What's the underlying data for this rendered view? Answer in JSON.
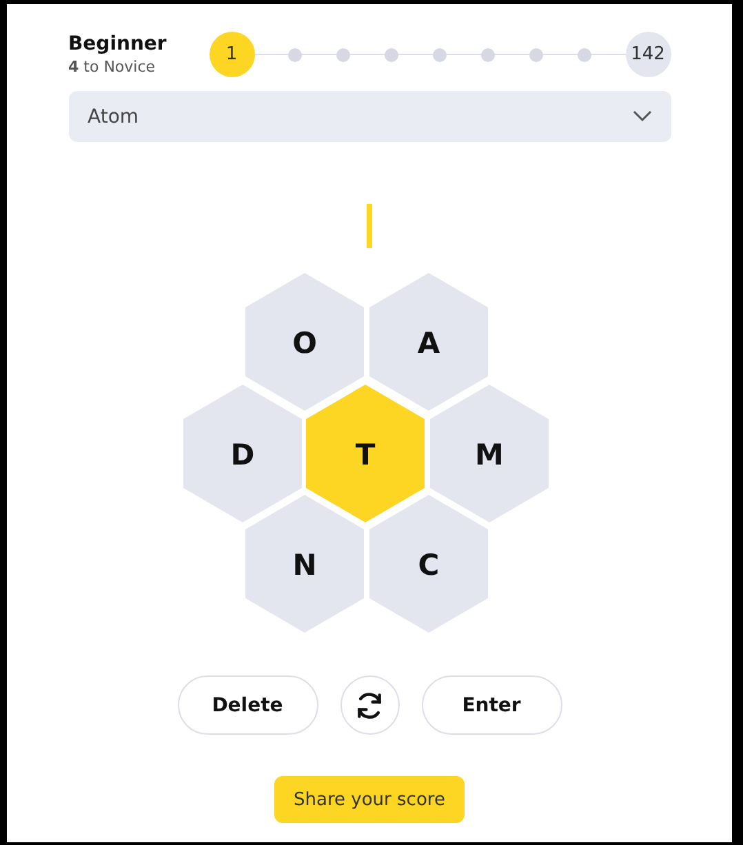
{
  "rank": {
    "title": "Beginner",
    "next": "**4** to Novice"
  },
  "milestones": [
    {
      "label": "1",
      "current": true
    },
    {
      "current": false
    },
    {
      "current": false
    },
    {
      "current": false
    },
    {
      "current": false
    },
    {
      "current": false
    },
    {
      "current": false
    },
    {
      "current": false
    },
    {
      "label": "142",
      "current": false
    }
  ],
  "word_list": {
    "value": "Atom"
  },
  "letters": [
    {
      "letter": "O",
      "center": false
    },
    {
      "letter": "A",
      "center": false
    },
    {
      "letter": "D",
      "center": false
    },
    {
      "letter": "T",
      "center": true
    },
    {
      "letter": "M",
      "center": false
    },
    {
      "letter": "N",
      "center": false
    },
    {
      "letter": "C",
      "center": false
    }
  ],
  "buttons": [
    {
      "kind": "text",
      "label": "Delete"
    },
    {
      "kind": "shuffle"
    },
    {
      "kind": "text",
      "label": "Enter"
    }
  ],
  "share": {
    "label": "Share your score"
  }
}
